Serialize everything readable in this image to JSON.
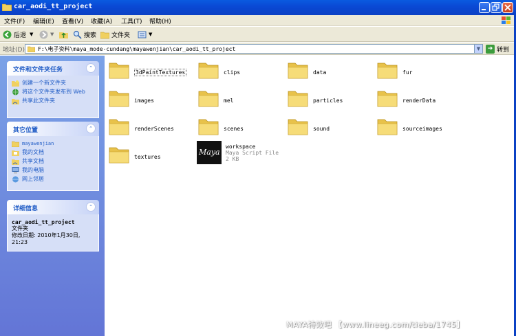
{
  "window": {
    "title": "car_aodi_tt_project"
  },
  "menu": [
    "文件(F)",
    "编辑(E)",
    "查看(V)",
    "收藏(A)",
    "工具(T)",
    "帮助(H)"
  ],
  "toolbar": {
    "back": "后退",
    "search": "搜索",
    "folders": "文件夹"
  },
  "address": {
    "label": "地址(D)",
    "path": "F:\\电子资料\\maya_mode-cundang\\mayawenjian\\car_aodi_tt_project",
    "go": "转到"
  },
  "tasks": {
    "title": "文件和文件夹任务",
    "items": [
      "创建一个新文件夹",
      "将这个文件夹发布到 Web",
      "共享此文件夹"
    ]
  },
  "places": {
    "title": "其它位置",
    "items": [
      "mayawenjian",
      "我的文档",
      "共享文档",
      "我的电脑",
      "网上邻居"
    ]
  },
  "details": {
    "title": "详细信息",
    "name": "car_aodi_tt_project",
    "type": "文件夹",
    "modified": "修改日期: 2010年1月30日, 21:23"
  },
  "files": [
    "3dPaintTextures",
    "clips",
    "data",
    "fur",
    "images",
    "mel",
    "particles",
    "renderData",
    "renderScenes",
    "scenes",
    "sound",
    "sourceimages",
    "textures"
  ],
  "workspace": {
    "name": "workspace",
    "type": "Maya Script File",
    "size": "2 KB",
    "icon_text": "Maya"
  },
  "watermark": "MAYA特效吧 【www.lineeg.com/tieba/1745】",
  "colors": {
    "titlebar": "#0a48d4",
    "taskpane": "#6f8fdf",
    "link": "#215dc6",
    "folder": "#f2d56a"
  }
}
